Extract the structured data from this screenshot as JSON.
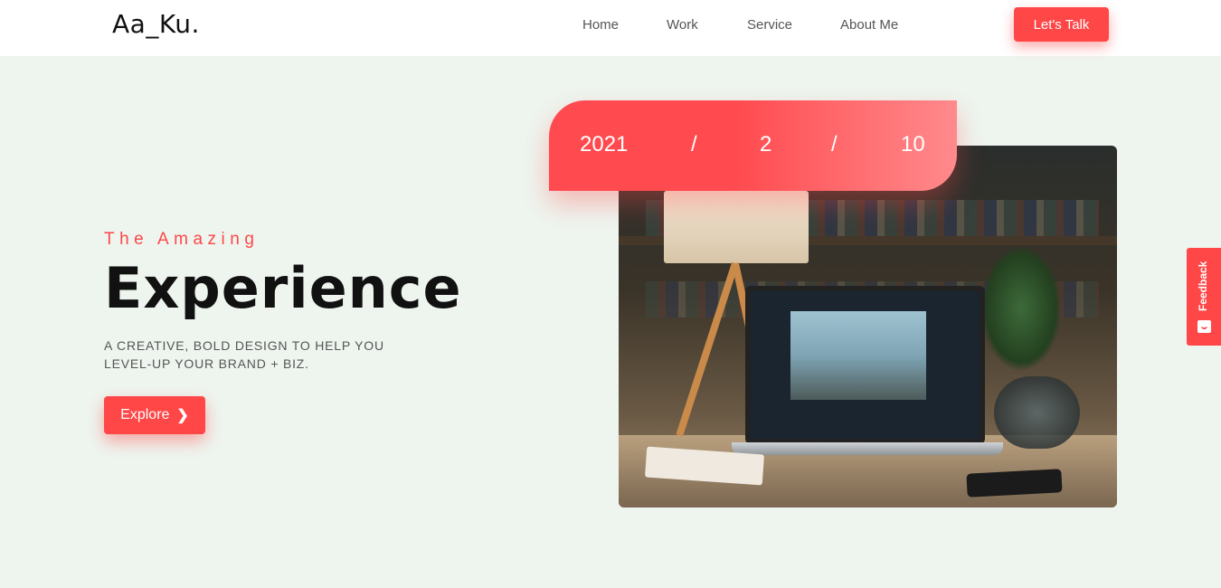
{
  "header": {
    "logo": "Aa_Ku.",
    "nav": [
      "Home",
      "Work",
      "Service",
      "About Me"
    ],
    "cta_label": "Let's Talk"
  },
  "hero": {
    "tagline": "The Amazing",
    "headline": "Experience",
    "description": "A CREATIVE, BOLD DESIGN TO HELP YOU LEVEL-UP YOUR BRAND + BIZ.",
    "explore_label": "Explore",
    "explore_icon": "chevron-right-icon"
  },
  "date_banner": {
    "year": "2021",
    "separator": "/",
    "month": "2",
    "day": "10"
  },
  "feedback": {
    "label": "Feedback",
    "icon": "smiley-icon"
  },
  "colors": {
    "accent": "#ff4747",
    "background": "#eef5ef",
    "header_bg": "#ffffff"
  }
}
